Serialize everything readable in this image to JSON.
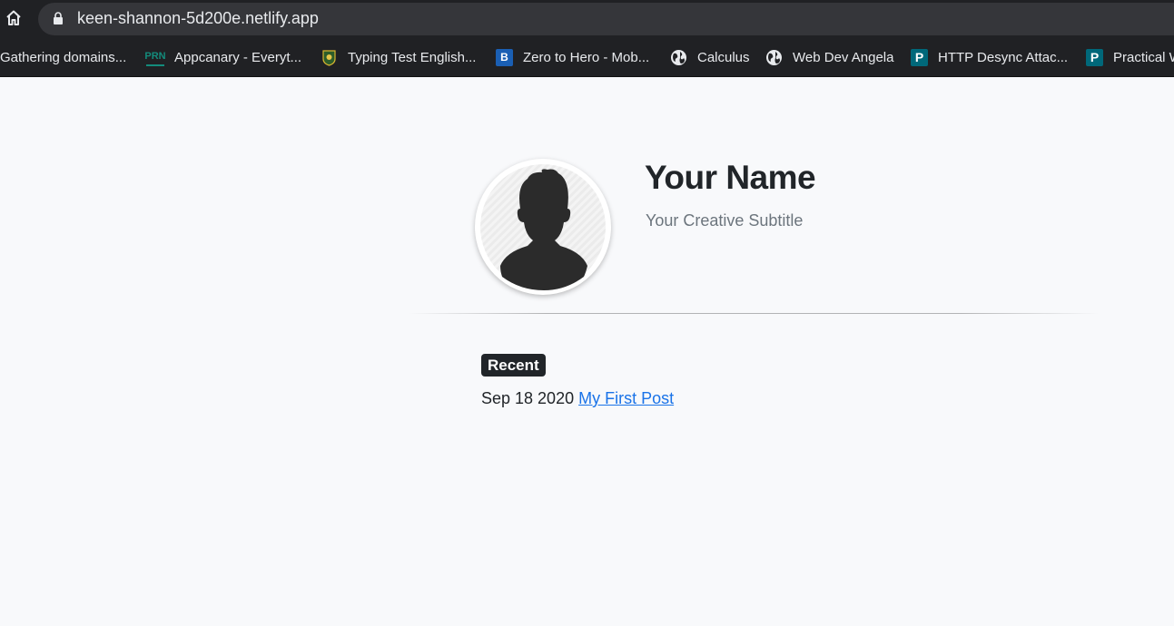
{
  "browser": {
    "url": "keen-shannon-5d200e.netlify.app",
    "bookmarks": [
      {
        "label": "Gathering domains...",
        "icon": "none"
      },
      {
        "label": "Appcanary - Everyt...",
        "icon": "prn-icon",
        "icon_text": "PRN",
        "icon_color": "#138c7c"
      },
      {
        "label": "Typing Test English...",
        "icon": "typing-test-icon"
      },
      {
        "label": "Zero to Hero - Mob...",
        "icon": "b-letter-icon",
        "icon_text": "B",
        "icon_color": "#1a5fb4"
      },
      {
        "label": "Calculus",
        "icon": "globe-icon"
      },
      {
        "label": "Web Dev Angela",
        "icon": "globe-icon"
      },
      {
        "label": "HTTP Desync Attac...",
        "icon": "p-letter-icon",
        "icon_text": "P",
        "icon_color": "#00687a"
      },
      {
        "label": "Practical W",
        "icon": "p-letter-icon",
        "icon_text": "P",
        "icon_color": "#00687a"
      }
    ]
  },
  "profile": {
    "name": "Your Name",
    "subtitle": "Your Creative Subtitle"
  },
  "posts": {
    "section_label": "Recent",
    "items": [
      {
        "date": "Sep 18 2020",
        "title": "My First Post"
      }
    ]
  },
  "colors": {
    "page_bg": "#f8f9fb",
    "text": "#212529",
    "muted": "#6c757d",
    "link": "#1a73e8"
  }
}
